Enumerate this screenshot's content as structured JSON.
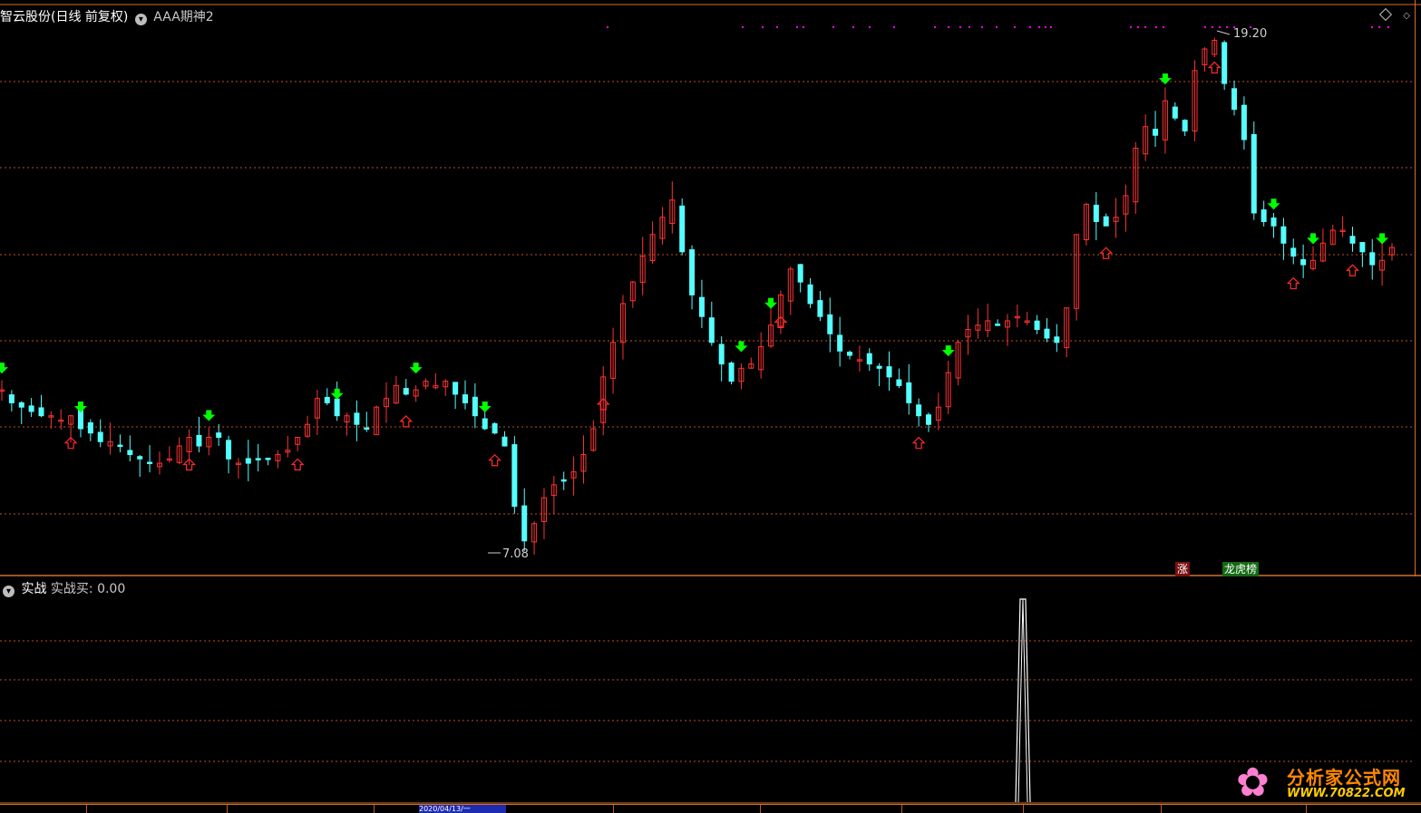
{
  "main_header": {
    "title": "智云股份(日线 前复权)",
    "indicator": "AAA期神2"
  },
  "sub_header": {
    "name": "实战",
    "value_label": "实战买: 0.00"
  },
  "price_labels": {
    "high": "19.20",
    "low": "7.08"
  },
  "badges": {
    "rise": "涨",
    "rank": "龙虎榜"
  },
  "time_axis": {
    "selected_date": "2020/04/13/一"
  },
  "watermark": {
    "title": "分析家公式网",
    "url": "WWW.70822.COM"
  },
  "colors": {
    "up": "#ff3232",
    "down": "#54ffff",
    "grid": "#c0501c",
    "signal_green": "#00ff00",
    "signal_red": "#ff2a2a",
    "magenta": "#ff00ff"
  },
  "chart_data": {
    "type": "candlestick",
    "price_range": [
      7.08,
      19.2
    ],
    "high": 19.2,
    "low": 7.08,
    "close_series": [
      10.9,
      10.6,
      10.5,
      10.4,
      10.3,
      10.3,
      10.2,
      10.3,
      10.0,
      9.9,
      9.7,
      9.7,
      9.6,
      9.4,
      9.3,
      9.2,
      9.2,
      9.3,
      9.6,
      9.8,
      9.6,
      9.8,
      9.8,
      9.3,
      9.2,
      9.2,
      9.3,
      9.3,
      9.4,
      9.5,
      9.8,
      10.1,
      10.7,
      10.6,
      10.3,
      10.3,
      10.1,
      10.0,
      10.5,
      10.7,
      11.0,
      10.8,
      10.9,
      11.1,
      11.0,
      11.1,
      10.8,
      10.6,
      10.3,
      10.0,
      9.9,
      9.6,
      8.2,
      7.4,
      7.8,
      8.4,
      8.7,
      8.8,
      9.0,
      9.4,
      10.0,
      11.2,
      12.0,
      12.9,
      13.4,
      14.0,
      14.5,
      14.9,
      15.3,
      14.1,
      13.1,
      12.6,
      12.0,
      11.5,
      11.1,
      11.4,
      11.5,
      11.9,
      12.4,
      13.1,
      13.7,
      13.4,
      12.9,
      12.6,
      12.2,
      11.8,
      11.7,
      11.6,
      11.5,
      11.4,
      11.2,
      11.0,
      10.6,
      10.3,
      10.1,
      10.5,
      11.3,
      12.0,
      12.3,
      12.4,
      12.5,
      12.4,
      12.5,
      12.6,
      12.5,
      12.3,
      12.1,
      12.0,
      12.8,
      14.5,
      15.2,
      14.8,
      14.7,
      14.9,
      15.4,
      16.5,
      17.0,
      16.8,
      17.6,
      17.2,
      16.9,
      18.3,
      18.8,
      19.0,
      18.0,
      17.4,
      16.7,
      15.0,
      14.8,
      14.7,
      14.3,
      14.0,
      13.8,
      13.9,
      14.3,
      14.6,
      14.6,
      14.3,
      14.1,
      13.8,
      13.9,
      14.2
    ],
    "sub_indicator": {
      "name": "实战买",
      "value": 0.0,
      "spike_value": 1.0
    }
  }
}
